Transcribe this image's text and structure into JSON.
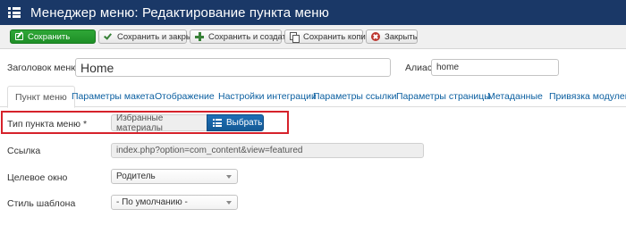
{
  "header": {
    "title": "Менеджер меню: Редактирование пункта меню"
  },
  "toolbar": {
    "save": "Сохранить",
    "save_close": "Сохранить и закрыть",
    "save_new": "Сохранить и создать",
    "save_copy": "Сохранить копию",
    "close": "Закрыть"
  },
  "form": {
    "title_label": "Заголовок меню",
    "title_value": "Home",
    "alias_label": "Алиас",
    "alias_value": "home"
  },
  "tabs": [
    {
      "label": "Пункт меню",
      "active": true
    },
    {
      "label": "Параметры макета"
    },
    {
      "label": "Отображение"
    },
    {
      "label": "Настройки интеграции"
    },
    {
      "label": "Параметры ссылки"
    },
    {
      "label": "Параметры страницы"
    },
    {
      "label": "Метаданные"
    },
    {
      "label": "Привязка модулей"
    }
  ],
  "fields": {
    "menu_type_label": "Тип пункта меню",
    "menu_type_value": "Избранные материалы",
    "select_button": "Выбрать",
    "link_label": "Ссылка",
    "link_value": "index.php?option=com_content&view=featured",
    "target_label": "Целевое окно",
    "target_value": "Родитель",
    "style_label": "Стиль шаблона",
    "style_value": "- По умолчанию -"
  },
  "colors": {
    "header_bg": "#1a3867",
    "save_button": "#2fa737",
    "select_button": "#1d6fb6",
    "highlight_border": "#d6222b",
    "tab_link": "#0b5fa0"
  },
  "icons": {
    "header": "menu-list-icon",
    "save": "edit-icon",
    "save_close": "check-icon",
    "save_new": "plus-icon",
    "save_copy": "copy-icon",
    "close": "close-circle-icon",
    "select": "list-icon"
  }
}
